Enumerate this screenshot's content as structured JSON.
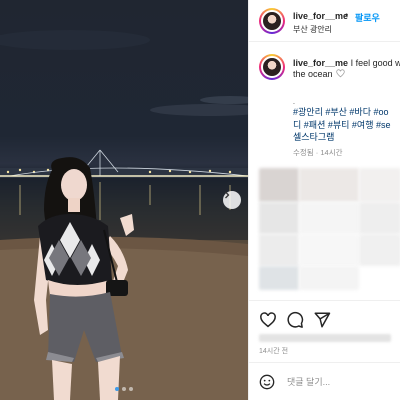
{
  "post": {
    "username": "live_for__me",
    "header_separator": "•",
    "follow_label": "팔로우",
    "location": "부산 광안리",
    "caption_line1": "I feel good w",
    "caption_line2": "the ocean",
    "caption_emoji": "white-heart-icon",
    "dot_marker": ".",
    "hashtags": [
      "#광안리 #부산 #바다 #oo",
      "디 #패션 #뷰티 #여행 #se",
      "셀스타그램"
    ],
    "edited_label": "수정됨 · 14시간",
    "likes_label": "",
    "time_label": "14시간 전",
    "comment_placeholder": "댓글 달기..."
  },
  "carousel": {
    "total": 3,
    "current": 1
  },
  "icons": {
    "like": "heart-icon",
    "comment": "comment-icon",
    "share": "share-icon",
    "emoji": "emoji-icon",
    "next": "chevron-right-icon"
  },
  "colors": {
    "link": "#00376b",
    "follow": "#0095f6",
    "muted": "#8e8e8e",
    "active_dot": "#3d9be9"
  }
}
